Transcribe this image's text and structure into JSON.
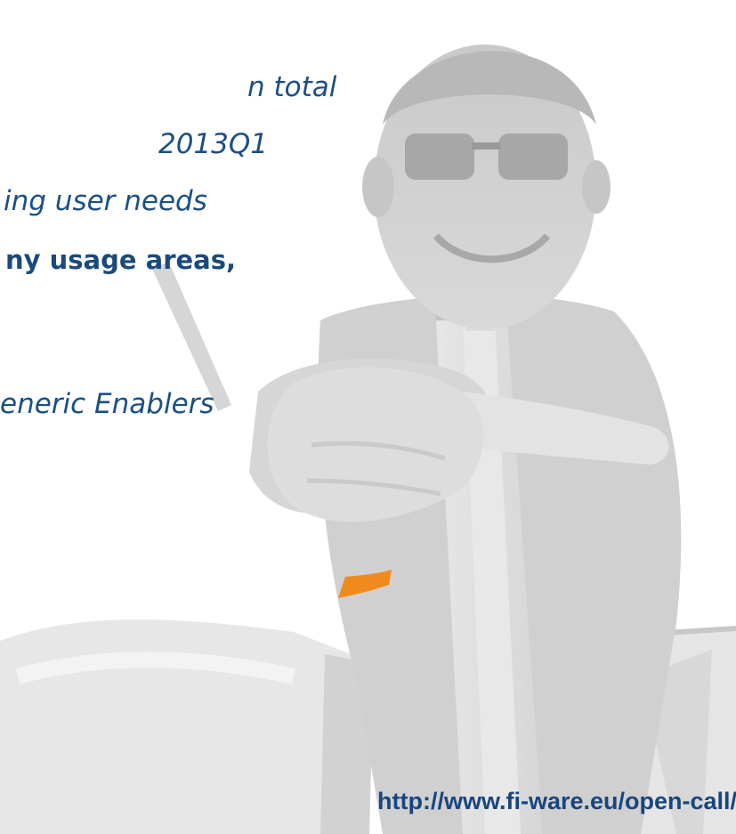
{
  "slide": {
    "lines": [
      "n total",
      "2013Q1",
      "ing user needs",
      "ny usage areas,",
      "eneric Enablers"
    ],
    "url": "http://www.fi-ware.eu/open-call/"
  },
  "colors": {
    "text": "#1b4f85",
    "accent": "#f08a1c",
    "photo_tint": "#cfcfcf"
  }
}
